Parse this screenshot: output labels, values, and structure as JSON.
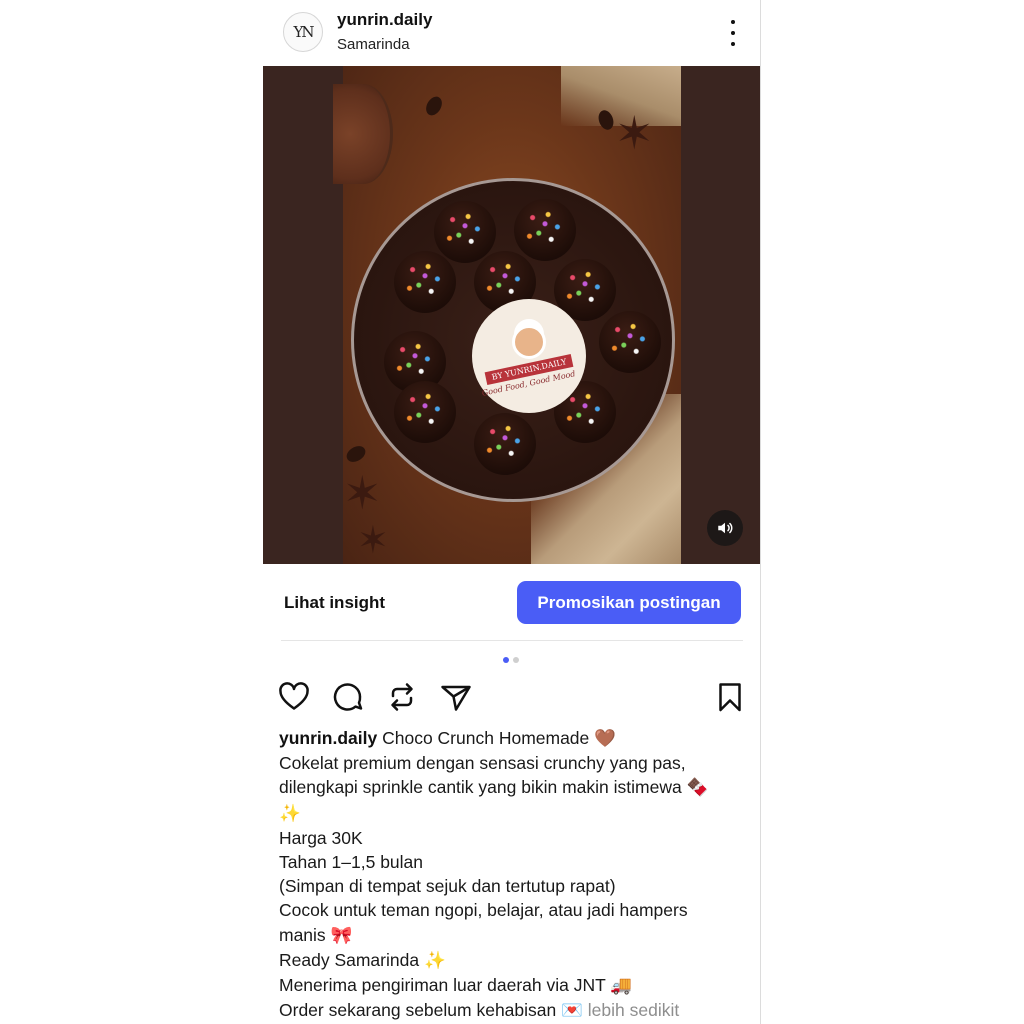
{
  "header": {
    "avatar_text": "YN",
    "username": "yunrin.daily",
    "location": "Samarinda",
    "more_icon": "more-vertical-icon"
  },
  "media": {
    "label_top": "BY YUNRIN.DAILY",
    "label_tagline": "Good Food, Good Mood",
    "sound_icon": "volume-icon"
  },
  "insight": {
    "link_label": "Lihat insight",
    "promote_label": "Promosikan postingan",
    "accent_color": "#4a5df6"
  },
  "carousel": {
    "count": 2,
    "active": 1
  },
  "actions": {
    "like_icon": "heart-icon",
    "comment_icon": "comment-icon",
    "repost_icon": "repost-icon",
    "share_icon": "send-icon",
    "save_icon": "bookmark-icon"
  },
  "caption": {
    "username": "yunrin.daily",
    "title": "Choco Crunch Homemade",
    "title_emoji": "🤎",
    "line2": "Cokelat premium dengan sensasi crunchy yang pas,",
    "line3": "dilengkapi sprinkle cantik yang bikin makin istimewa",
    "line3_emoji": "🍫",
    "line4_emoji": "✨",
    "line5": "Harga 30K",
    "line6": "Tahan 1–1,5 bulan",
    "line7": "(Simpan di tempat sejuk dan tertutup rapat)",
    "line8": "Cocok untuk teman ngopi, belajar, atau jadi hampers",
    "line9": "manis",
    "line9_emoji": "🎀",
    "line10": "Ready Samarinda",
    "line10_emoji": "✨",
    "line11": "Menerima pengiriman luar daerah via JNT",
    "line11_emoji": "🚚",
    "line12": "Order sekarang sebelum kehabisan",
    "line12_emoji": "💌",
    "more_label": "lebih sedikit"
  }
}
